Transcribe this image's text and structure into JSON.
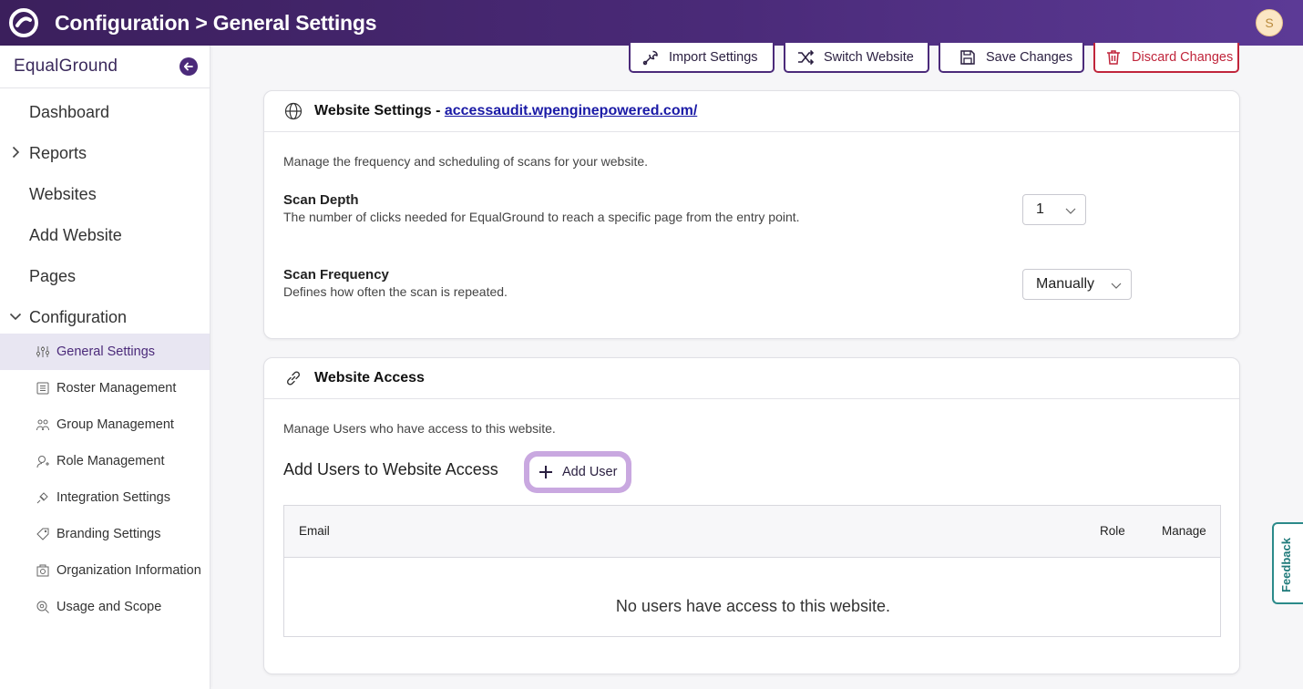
{
  "header": {
    "title": "Configuration > General Settings",
    "avatar_initial": "S",
    "brand_color": "#4a2a78"
  },
  "sidebar": {
    "brand": "EqualGround",
    "items": [
      {
        "label": "Dashboard"
      },
      {
        "label": "Reports"
      },
      {
        "label": "Websites"
      },
      {
        "label": "Add Website"
      },
      {
        "label": "Pages"
      },
      {
        "label": "Configuration"
      }
    ],
    "sub_items": [
      {
        "label": "General Settings",
        "icon": "sliders-icon",
        "active": true
      },
      {
        "label": "Roster Management",
        "icon": "list-icon"
      },
      {
        "label": "Group Management",
        "icon": "group-icon"
      },
      {
        "label": "Role Management",
        "icon": "user-role-icon"
      },
      {
        "label": "Integration Settings",
        "icon": "plug-icon"
      },
      {
        "label": "Branding Settings",
        "icon": "tag-icon"
      },
      {
        "label": "Organization Information",
        "icon": "building-icon"
      },
      {
        "label": "Usage and Scope",
        "icon": "scope-icon"
      }
    ]
  },
  "toolbar": {
    "import_label": "Import Settings",
    "switch_label": "Switch Website",
    "save_label": "Save Changes",
    "discard_label": "Discard Changes"
  },
  "website_settings": {
    "title_prefix": "Website Settings - ",
    "url": "accessaudit.wpenginepowered.com/",
    "description": "Manage the frequency and scheduling of scans for your website.",
    "scan_depth": {
      "title": "Scan Depth",
      "help": "The number of clicks needed for EqualGround to reach a specific page from the entry point.",
      "value": "1"
    },
    "scan_frequency": {
      "title": "Scan Frequency",
      "help": "Defines how often the scan is repeated.",
      "value": "Manually"
    }
  },
  "website_access": {
    "title": "Website Access",
    "description": "Manage Users who have access to this website.",
    "add_heading": "Add Users to Website Access",
    "add_user_label": "Add User",
    "columns": {
      "email": "Email",
      "role": "Role",
      "manage": "Manage"
    },
    "empty_message": "No users have access to this website."
  },
  "feedback_label": "Feedback"
}
